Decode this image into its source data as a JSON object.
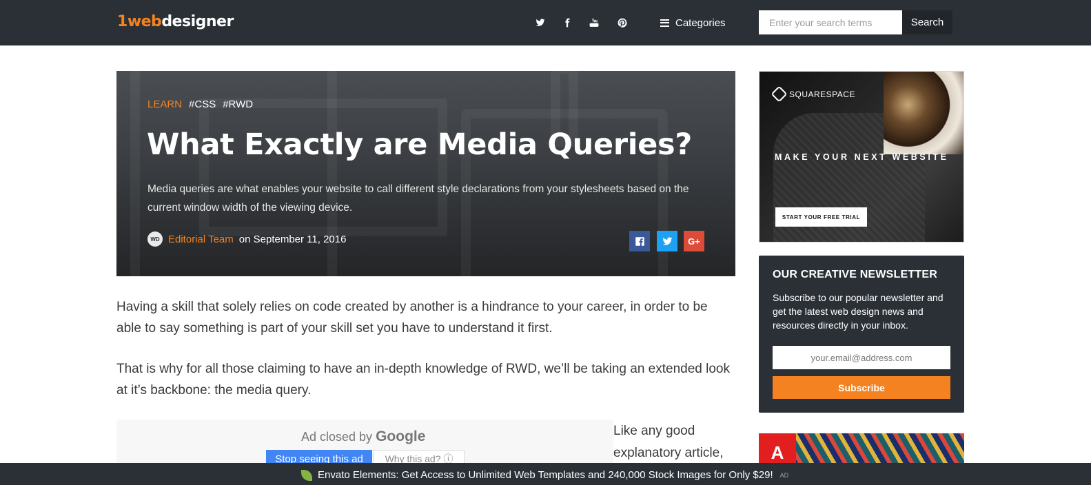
{
  "header": {
    "logo": {
      "one": "1",
      "web": "web",
      "designer": "designer"
    },
    "social_icons": [
      "twitter-icon",
      "facebook-icon",
      "youtube-icon",
      "pinterest-icon"
    ],
    "categories_label": "Categories",
    "search_placeholder": "Enter your search terms",
    "search_button": "Search"
  },
  "hero": {
    "tags": {
      "learn": "LEARN",
      "tag1": "#CSS",
      "tag2": "#RWD"
    },
    "title": "What Exactly are Media Queries?",
    "description": "Media queries are what enables your website to call different style declarations from your stylesheets based on the current window width of the viewing device.",
    "author_avatar": "WD",
    "author": "Editorial Team",
    "date_text": "on September 11, 2016",
    "share": [
      "facebook-icon",
      "twitter-icon",
      "google-plus-icon"
    ],
    "gplus_label": "G+"
  },
  "article": {
    "p1": "Having a skill that solely relies on code created by another is a hindrance to your career, in order to be able to say something is part of your skill set you have to understand it first.",
    "p2": "That is why for all those claiming to have an in-depth knowledge of RWD, we’ll be taking an extended look at it’s backbone: the media query.",
    "side_text": "Like any good explanatory article,",
    "ad_closed": {
      "prefix": "Ad closed by",
      "brand": "Google",
      "stop": "Stop seeing this ad",
      "why": "Why this ad? ⓘ"
    }
  },
  "sidebar": {
    "squarespace": {
      "brand": "SQUARESPACE",
      "headline": "MAKE YOUR NEXT WEBSITE",
      "cta": "START YOUR FREE TRIAL"
    },
    "newsletter": {
      "title": "OUR CREATIVE NEWSLETTER",
      "description": "Subscribe to our popular newsletter and get the latest web design news and resources directly in your inbox.",
      "email_placeholder": "your.email@address.com",
      "subscribe": "Subscribe"
    },
    "adobe_mark": "A"
  },
  "bottom_bar": {
    "text": "Envato Elements: Get Access to Unlimited Web Templates and 240,000 Stock Images for Only $29!",
    "ad_label": "AD"
  },
  "colors": {
    "accent": "#f58220",
    "nav_bg": "#2b3037",
    "facebook": "#3b5998",
    "twitter": "#1da1f2",
    "google_plus": "#dd4b39",
    "google_blue": "#4285f4"
  }
}
